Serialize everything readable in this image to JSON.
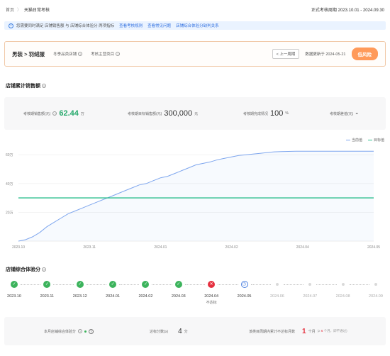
{
  "breadcrumb": {
    "home": "首页",
    "separator": "〉",
    "current": "天猫日常考核"
  },
  "period": {
    "label": "正式考核周期",
    "value": "2023.10.01 - 2024.09.30"
  },
  "notice": {
    "text": "您需要同时满足 店铺销售额 与 店铺综合体验分 两项指标",
    "links": [
      "查看考核规则",
      "查看常见问题",
      "店铺综合体验分缺判关系"
    ]
  },
  "category_card": {
    "name": "男装 > 羽绒服",
    "meta1": "冬季品类店铺",
    "meta2": "考核主营类目",
    "prev_button": "< 上一周期",
    "update_text": "数据更新于 2024-05-21",
    "risk_button": "低风险"
  },
  "sales": {
    "title": "店铺累计销售额",
    "stats": [
      {
        "label": "考核期销售额(元)",
        "value": "62.44",
        "unit": "万"
      },
      {
        "label": "考核期目标销售额(元)",
        "value": "300,000",
        "unit": "元"
      },
      {
        "label": "考核期完成情况",
        "value": "100",
        "unit": "%"
      },
      {
        "label": "考核期差值(元)",
        "value": "-",
        "unit": ""
      }
    ]
  },
  "chart_data": {
    "type": "line",
    "x": [
      "2023.10",
      "2023.11",
      "2024.01",
      "2024.02",
      "2024.04",
      "2024.05"
    ],
    "yticks": [
      "20万",
      "40万",
      "60万"
    ],
    "ylim": [
      0,
      66
    ],
    "series": [
      {
        "name": "当前值",
        "color": "#7ea6ee",
        "points": [
          [
            0,
            0
          ],
          [
            2,
            1
          ],
          [
            4,
            3
          ],
          [
            6,
            6
          ],
          [
            8,
            10
          ],
          [
            10,
            13
          ],
          [
            12,
            16
          ],
          [
            14,
            19
          ],
          [
            16,
            21
          ],
          [
            18,
            23
          ],
          [
            20,
            25
          ],
          [
            22,
            27
          ],
          [
            24,
            29
          ],
          [
            26,
            31
          ],
          [
            28,
            33
          ],
          [
            30,
            35
          ],
          [
            32,
            37
          ],
          [
            34,
            39
          ],
          [
            36,
            40
          ],
          [
            38,
            42
          ],
          [
            40,
            44
          ],
          [
            42,
            45
          ],
          [
            44,
            47
          ],
          [
            46,
            49
          ],
          [
            48,
            51
          ],
          [
            50,
            53
          ],
          [
            52,
            54
          ],
          [
            54,
            55
          ],
          [
            56,
            56.5
          ],
          [
            58,
            57.5
          ],
          [
            60,
            58.5
          ],
          [
            62,
            59.5
          ],
          [
            64,
            60
          ],
          [
            66,
            60.5
          ],
          [
            68,
            61
          ],
          [
            70,
            61.5
          ],
          [
            72,
            62
          ],
          [
            74,
            62.2
          ],
          [
            76,
            62.3
          ],
          [
            78,
            62.4
          ],
          [
            80,
            62.44
          ],
          [
            100,
            62.44
          ]
        ]
      },
      {
        "name": "目标值",
        "color": "#2fbf8f",
        "points": [
          [
            0,
            30
          ],
          [
            100,
            30
          ]
        ]
      }
    ]
  },
  "timeline": {
    "title": "店铺综合体验分",
    "items": [
      {
        "label": "2023.10",
        "status": "pass"
      },
      {
        "label": "2023.11",
        "status": "pass"
      },
      {
        "label": "2023.12",
        "status": "pass"
      },
      {
        "label": "2024.01",
        "status": "pass"
      },
      {
        "label": "2024.02",
        "status": "pass"
      },
      {
        "label": "2024.03",
        "status": "pass"
      },
      {
        "label": "2024.04",
        "status": "fail",
        "sub": "不达标"
      },
      {
        "label": "2024.05",
        "status": "current"
      },
      {
        "label": "2024.06",
        "status": "future"
      },
      {
        "label": "2024.07",
        "status": "future"
      },
      {
        "label": "2024.08",
        "status": "future"
      },
      {
        "label": "2024.09",
        "status": "future"
      }
    ]
  },
  "score_summary": {
    "item1_label": "本月店铺综合体验分",
    "item2_label": "达标分数(≥)",
    "item2_value": "4",
    "item2_unit": "分",
    "item3_label": "该类目周期内累计不达标月数",
    "item3_value": "1",
    "item3_unit": "个月",
    "item3_note_prefix": "(≥",
    "item3_note_value": "6",
    "item3_note_suffix": "个月，即不通过)"
  }
}
